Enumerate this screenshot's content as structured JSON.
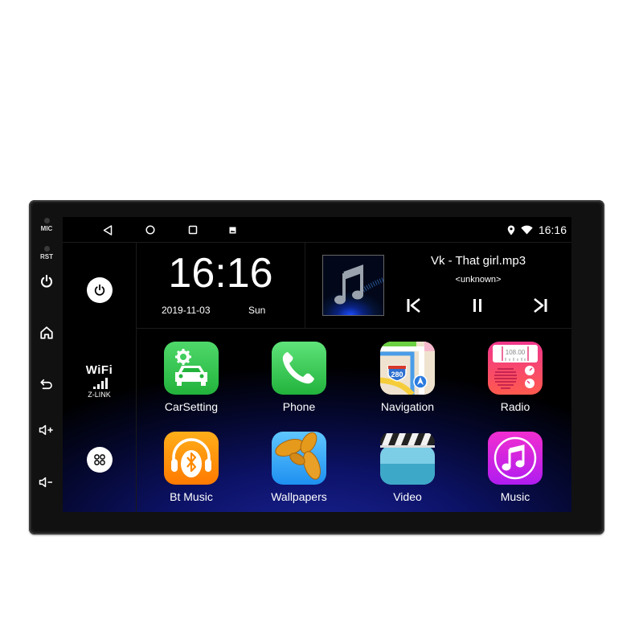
{
  "device": {
    "hardware_buttons": [
      {
        "id": "mic",
        "label": "MIC",
        "icon": "mic-led-icon"
      },
      {
        "id": "rst",
        "label": "RST",
        "icon": "reset-led-icon"
      },
      {
        "id": "power",
        "icon": "power-icon"
      },
      {
        "id": "home",
        "icon": "home-icon"
      },
      {
        "id": "back",
        "icon": "back-icon"
      },
      {
        "id": "vol-up",
        "icon": "volume-up-icon"
      },
      {
        "id": "vol-down",
        "icon": "volume-down-icon"
      }
    ]
  },
  "status_bar": {
    "nav": [
      "back-icon",
      "home-circle-icon",
      "recents-square-icon",
      "screenshot-icon"
    ],
    "icons": [
      "location-icon",
      "wifi-icon"
    ],
    "time": "16:16"
  },
  "left_panel": {
    "power_button": "power-icon",
    "wifi": {
      "title": "WiFi",
      "subtitle": "Z-LINK"
    },
    "apps_button": "apps-grid-icon"
  },
  "clock": {
    "time": "16:16",
    "date": "2019-11-03",
    "day": "Sun"
  },
  "media": {
    "title": "Vk - That girl.mp3",
    "artist": "<unknown>",
    "controls": [
      "previous-icon",
      "pause-icon",
      "next-icon"
    ]
  },
  "apps": [
    {
      "label": "CarSetting",
      "icon": "car-setting-icon",
      "color": "#34c759"
    },
    {
      "label": "Phone",
      "icon": "phone-icon",
      "color": "#34c759"
    },
    {
      "label": "Navigation",
      "icon": "navigation-map-icon",
      "color": "#f2e6d3"
    },
    {
      "label": "Radio",
      "icon": "radio-icon",
      "color": "#f0406a",
      "freq": "108.00"
    },
    {
      "label": "Bt Music",
      "icon": "bluetooth-music-icon",
      "color": "#ff8a00"
    },
    {
      "label": "Wallpapers",
      "icon": "wallpapers-icon",
      "color": "#2aa8ff"
    },
    {
      "label": "Video",
      "icon": "video-clapper-icon",
      "color": "#5ec4e0"
    },
    {
      "label": "Music",
      "icon": "music-note-icon",
      "color": "#e01ac8"
    }
  ],
  "nav_shield": "280"
}
